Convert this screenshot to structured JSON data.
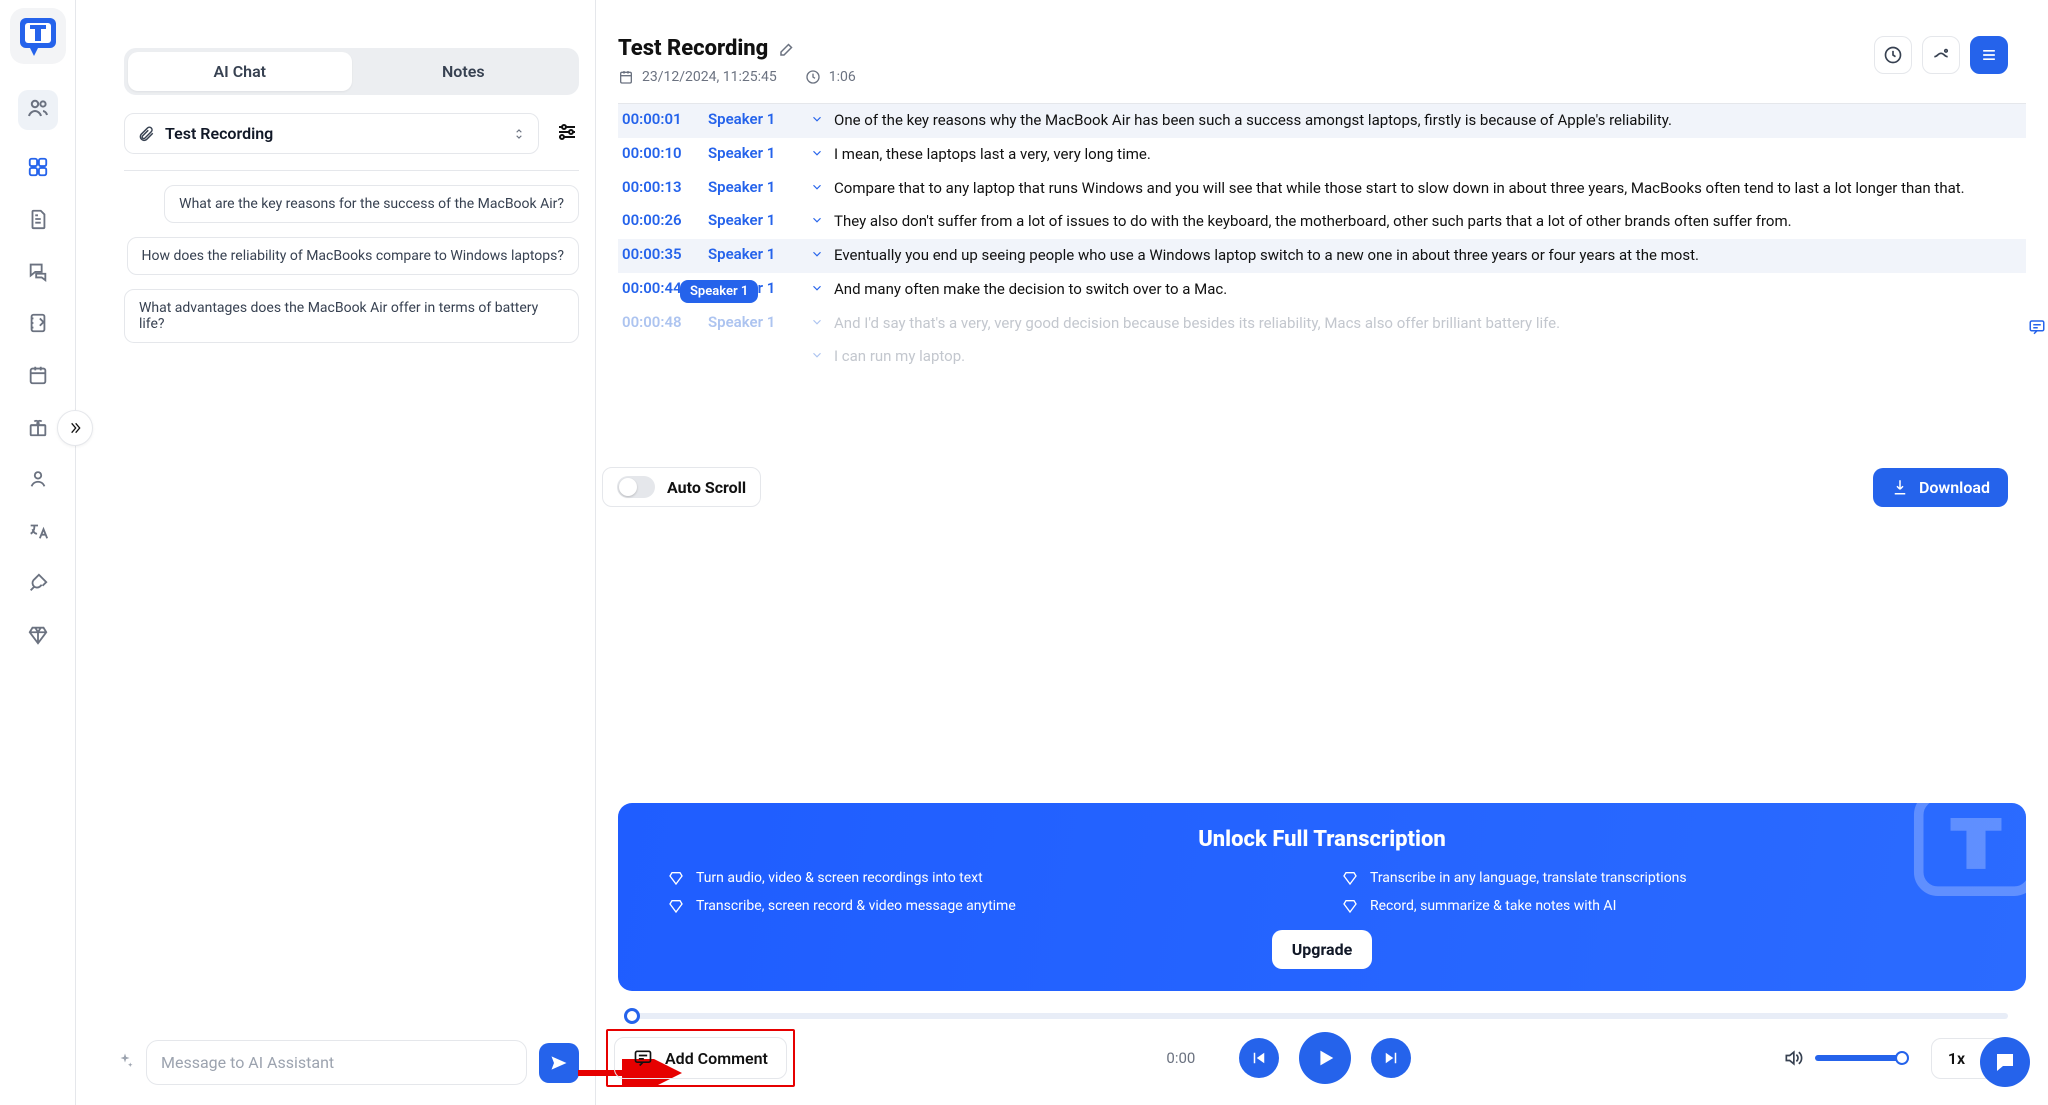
{
  "colors": {
    "primary": "#2563eb"
  },
  "tabs": {
    "ai_chat": "AI Chat",
    "notes": "Notes"
  },
  "source": {
    "label": "Test Recording"
  },
  "suggestions": [
    "What are the key reasons for the success of the MacBook Air?",
    "How does the reliability of MacBooks compare to Windows laptops?",
    "What advantages does the MacBook Air offer in terms of battery life?"
  ],
  "composer": {
    "placeholder": "Message to AI Assistant"
  },
  "doc": {
    "title": "Test Recording",
    "date": "23/12/2024, 11:25:45",
    "duration": "1:06"
  },
  "autoscroll_label": "Auto Scroll",
  "download_label": "Download",
  "speaker_tag": "Speaker 1",
  "transcript": [
    {
      "ts": "00:00:01",
      "spk": "Speaker 1",
      "txt": "One of the key reasons why the MacBook Air has been such a success amongst laptops, firstly is because of Apple's reliability.",
      "bg": true
    },
    {
      "ts": "00:00:10",
      "spk": "Speaker 1",
      "txt": "I mean, these laptops last a very, very long time."
    },
    {
      "ts": "00:00:13",
      "spk": "Speaker 1",
      "txt": "Compare that to any laptop that runs Windows and you will see that while those start to slow down in about three years, MacBooks often tend to last a lot longer than that."
    },
    {
      "ts": "00:00:26",
      "spk": "Speaker 1",
      "txt": "They also don't suffer from a lot of issues to do with the keyboard, the motherboard, other such parts that a lot of other brands often suffer from."
    },
    {
      "ts": "00:00:35",
      "spk": "Speaker 1",
      "txt": "Eventually you end up seeing people who use a Windows laptop switch to a new one in about three years or four years at the most.",
      "bg": true,
      "comment": true
    },
    {
      "ts": "00:00:44",
      "spk": "Speaker 1",
      "txt": "And many often make the decision to switch over to a Mac."
    },
    {
      "ts": "00:00:48",
      "spk": "Speaker 1",
      "txt": "And I'd say that's a very, very good decision because besides its reliability, Macs also offer brilliant battery life.",
      "dim": true
    },
    {
      "ts": "",
      "spk": "",
      "txt": "I can run my laptop.",
      "dim": true,
      "expand_only": true
    }
  ],
  "upsell": {
    "title": "Unlock Full Transcription",
    "features": [
      "Turn audio, video & screen recordings into text",
      "Transcribe in any language, translate transcriptions",
      "Transcribe, screen record & video message anytime",
      "Record, summarize & take notes with AI"
    ],
    "upgrade": "Upgrade"
  },
  "player": {
    "add_comment": "Add Comment",
    "time": "0:00",
    "speed": "1x"
  }
}
